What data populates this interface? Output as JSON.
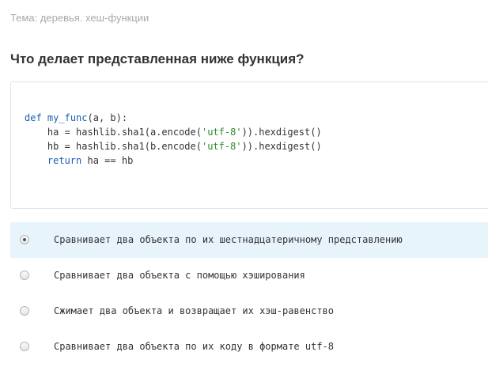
{
  "topic": "Тема: деревья. хеш-функции",
  "question": "Что делает представленная ниже функция?",
  "code": {
    "line1": {
      "kw": "def",
      "fn": "my_func",
      "rest": "(a, b):"
    },
    "line2": {
      "pre": "ha = hashlib.sha1(a.encode(",
      "str": "'utf-8'",
      "post": ")).hexdigest()"
    },
    "line3": {
      "pre": "hb = hashlib.sha1(b.encode(",
      "str": "'utf-8'",
      "post": ")).hexdigest()"
    },
    "line4": {
      "kw": "return",
      "rest": "ha == hb"
    }
  },
  "options": [
    {
      "label": "Сравнивает два объекта по их шестнадцатеричному представлению",
      "selected": true
    },
    {
      "label": "Сравнивает два объекта с помощью хэширования",
      "selected": false
    },
    {
      "label": "Сжимает два объекта и возвращает их хэш-равенство",
      "selected": false
    },
    {
      "label": "Сравнивает два объекта по их коду в формате utf-8",
      "selected": false
    }
  ]
}
